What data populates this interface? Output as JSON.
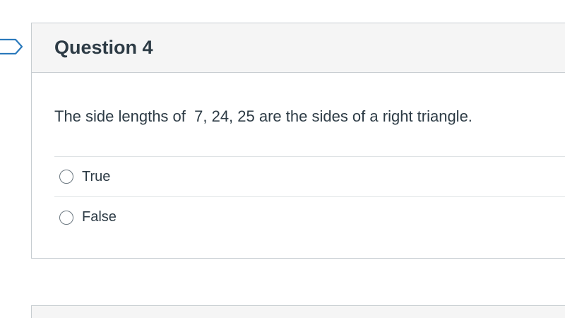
{
  "question": {
    "title": "Question 4",
    "text": "The side lengths of  7, 24, 25 are the sides of a right triangle.",
    "answers": [
      {
        "label": "True",
        "selected": false
      },
      {
        "label": "False",
        "selected": false
      }
    ]
  },
  "colors": {
    "accent": "#2b7abc",
    "header_bg": "#f5f5f5",
    "border": "#c7cdd1",
    "text": "#2d3b45"
  },
  "icons": {
    "flag": "bookmark-flag-icon"
  }
}
